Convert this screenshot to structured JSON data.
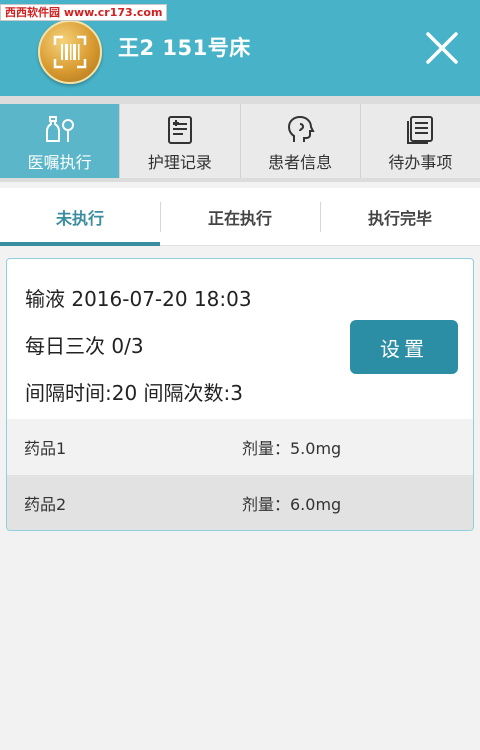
{
  "watermark": "西西软件园 www.cr173.com",
  "header": {
    "title": "王2  151号床",
    "avatar_icon": "barcode-scan-icon",
    "close_icon": "close-icon",
    "bg_color": "#48b3c8"
  },
  "nav_tabs": [
    {
      "label": "医嘱执行",
      "icon": "medicine-bottle-icon",
      "active": true
    },
    {
      "label": "护理记录",
      "icon": "record-document-icon",
      "active": false
    },
    {
      "label": "患者信息",
      "icon": "patient-head-icon",
      "active": false
    },
    {
      "label": "待办事项",
      "icon": "todo-list-icon",
      "active": false
    }
  ],
  "sub_tabs": [
    {
      "label": "未执行",
      "active": true
    },
    {
      "label": "正在执行",
      "active": false
    },
    {
      "label": "执行完毕",
      "active": false
    }
  ],
  "order": {
    "type_time": "输液  2016-07-20 18:03",
    "frequency": "每日三次  0/3",
    "interval": "间隔时间:20  间隔次数:3",
    "button_label": "设置",
    "drugs": [
      {
        "name": "药品1",
        "dose": "剂量：5.0mg"
      },
      {
        "name": "药品2",
        "dose": "剂量：6.0mg"
      }
    ]
  },
  "colors": {
    "accent": "#3a8d9f",
    "button": "#2c8ea5",
    "active_tab": "#5cb6c9"
  }
}
